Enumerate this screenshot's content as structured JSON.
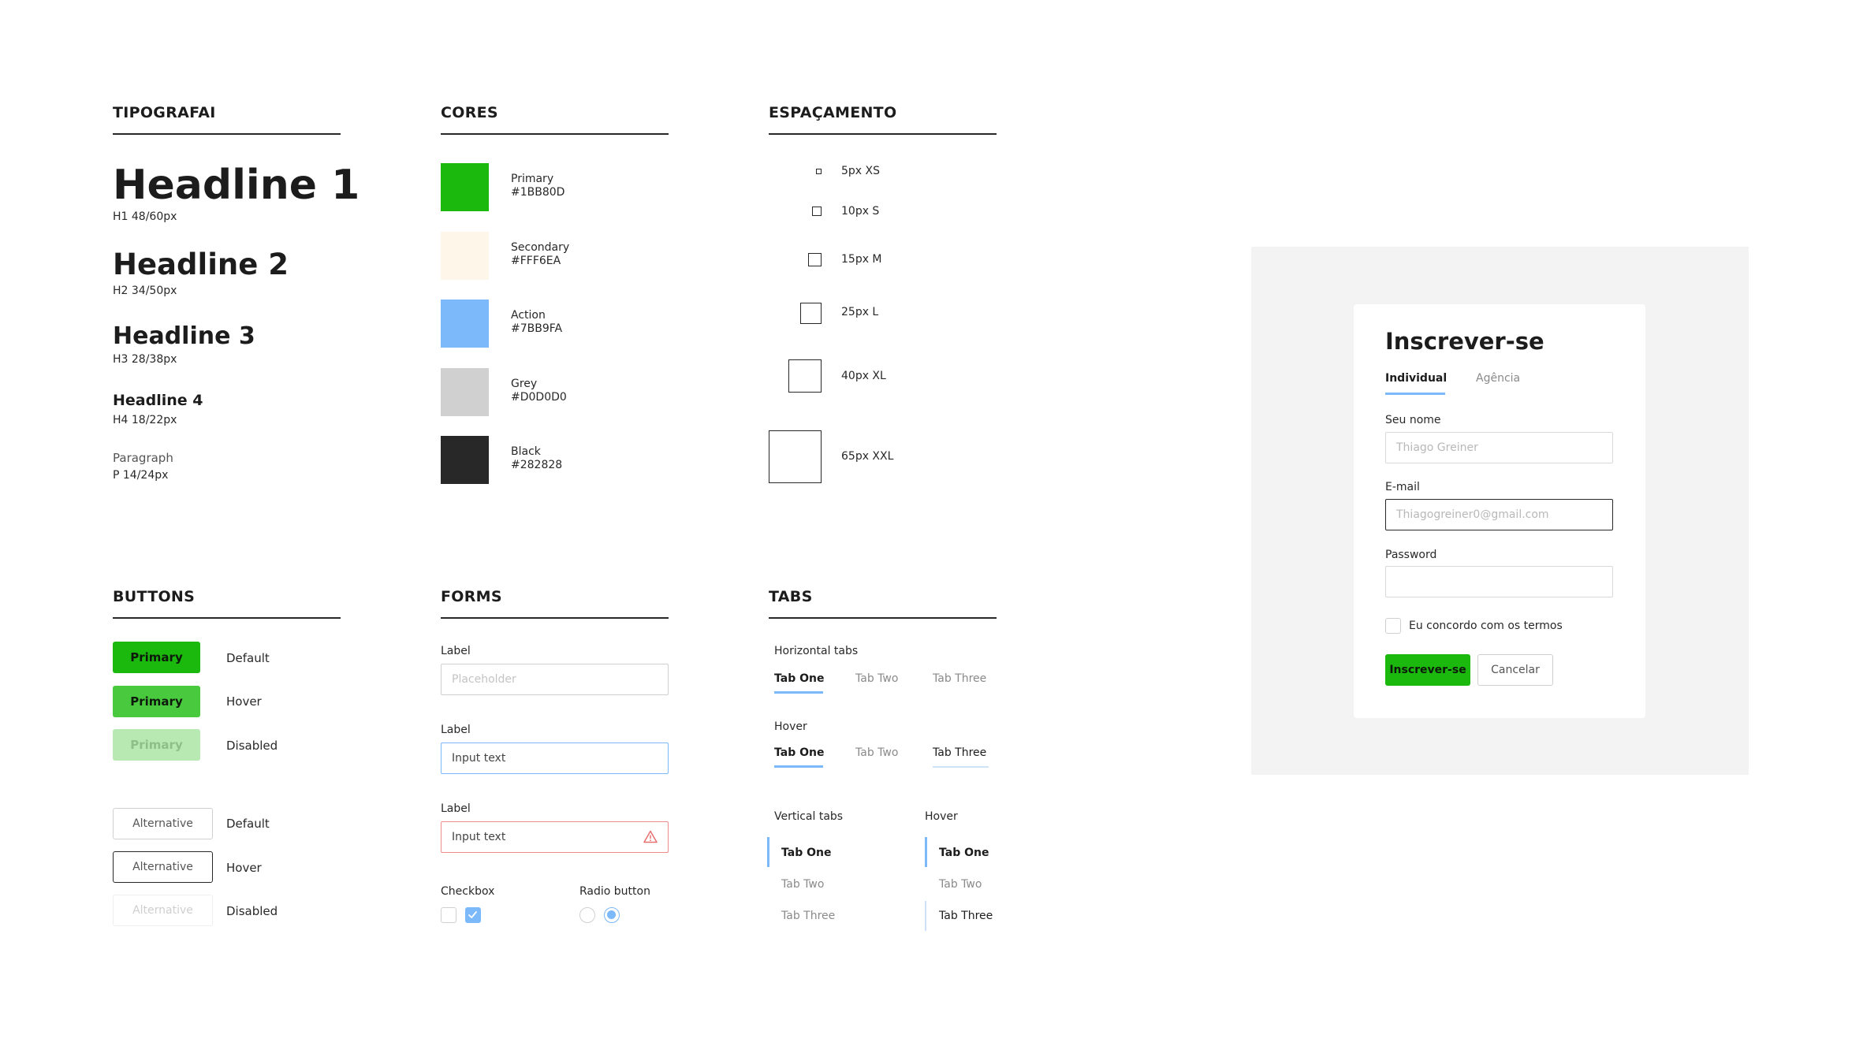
{
  "sections": {
    "typography": "TIPOGRAFAI",
    "colors": "CORES",
    "spacing": "ESPAÇAMENTO",
    "buttons": "BUTTONS",
    "forms": "FORMS",
    "tabs": "TABS"
  },
  "typography": {
    "h1": "Headline 1",
    "h1_spec": "H1 48/60px",
    "h2": "Headline 2",
    "h2_spec": "H2 34/50px",
    "h3": "Headline 3",
    "h3_spec": "H3 28/38px",
    "h4": "Headline 4",
    "h4_spec": "H4 18/22px",
    "paragraph": "Paragraph",
    "paragraph_spec": "P 14/24px"
  },
  "colors": [
    {
      "name": "Primary",
      "hex": "#1BB80D"
    },
    {
      "name": "Secondary",
      "hex": "#FFF6EA"
    },
    {
      "name": "Action",
      "hex": "#7BB9FA"
    },
    {
      "name": "Grey",
      "hex": "#D0D0D0"
    },
    {
      "name": "Black",
      "hex": "#282828"
    }
  ],
  "spacing": [
    {
      "label": "5px XS"
    },
    {
      "label": "10px S"
    },
    {
      "label": "15px M"
    },
    {
      "label": "25px L"
    },
    {
      "label": "40px XL"
    },
    {
      "label": "65px XXL"
    }
  ],
  "buttons": {
    "primary_label": "Primary",
    "alternative_label": "Alternative",
    "state_default": "Default",
    "state_hover": "Hover",
    "state_disabled": "Disabled"
  },
  "forms": {
    "label": "Label",
    "placeholder": "Placeholder",
    "input_text": "Input text",
    "checkbox_label": "Checkbox",
    "radio_label": "Radio button"
  },
  "tabs": {
    "horizontal_title": "Horizontal tabs",
    "hover_title": "Hover",
    "vertical_title": "Vertical tabs",
    "tab_one": "Tab One",
    "tab_two": "Tab Two",
    "tab_three": "Tab Three"
  },
  "signup": {
    "title": "Inscrever-se",
    "tab_individual": "Individual",
    "tab_agency": "Agência",
    "name_label": "Seu  nome",
    "name_placeholder": "Thiago Greiner",
    "email_label": "E-mail",
    "email_placeholder": "Thiagogreiner0@gmail.com",
    "password_label": "Password",
    "terms_label": "Eu concordo com os termos",
    "submit_label": "Inscrever-se",
    "cancel_label": "Cancelar"
  }
}
